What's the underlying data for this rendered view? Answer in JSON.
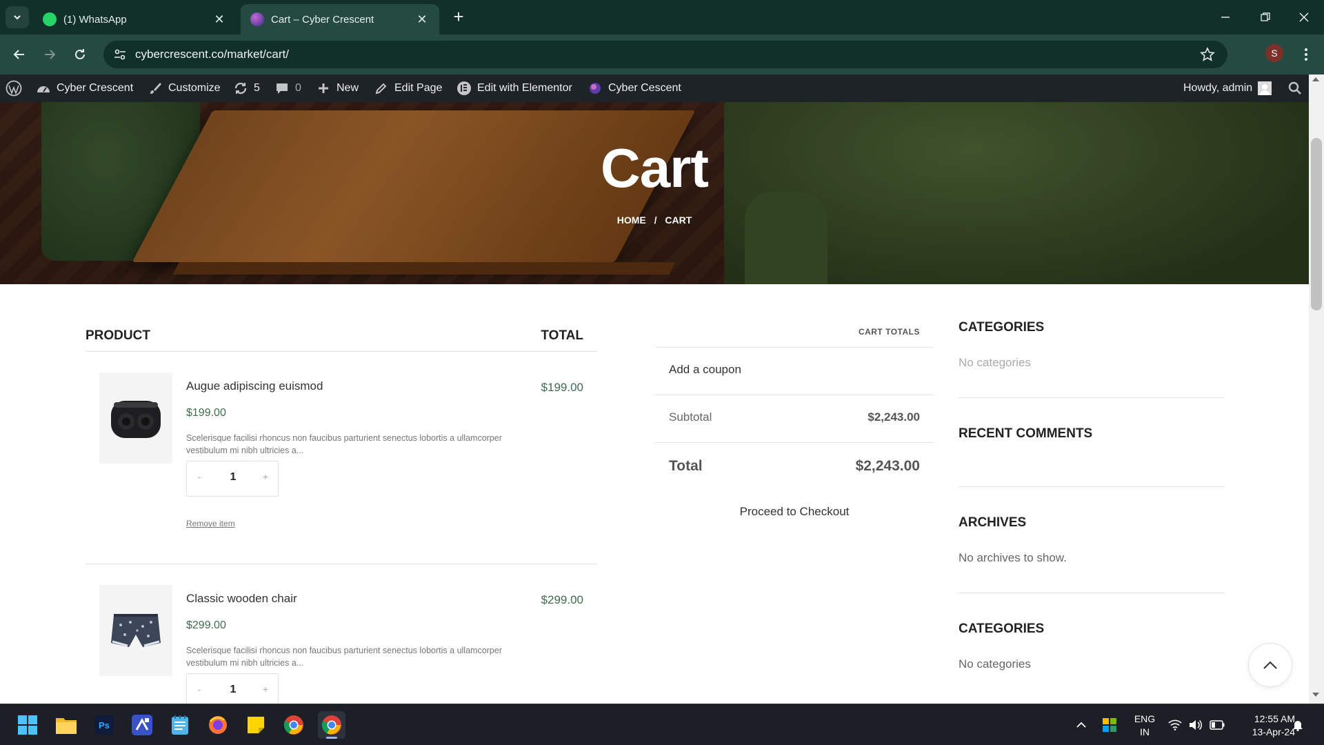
{
  "browser": {
    "tabs": [
      {
        "title": "(1) WhatsApp",
        "active": false
      },
      {
        "title": "Cart – Cyber Crescent",
        "active": true
      }
    ],
    "url": "cybercrescent.co/market/cart/",
    "profile_initial": "S"
  },
  "adminbar": {
    "site_name": "Cyber Crescent",
    "customize": "Customize",
    "updates_count": "5",
    "comments_count": "0",
    "new": "New",
    "edit_page": "Edit Page",
    "edit_elementor": "Edit with Elementor",
    "site_link": "Cyber Cescent",
    "howdy": "Howdy, admin"
  },
  "hero": {
    "title": "Cart",
    "breadcrumb": {
      "home": "HOME",
      "separator": "/",
      "current": "CART"
    }
  },
  "cart": {
    "col_product": "PRODUCT",
    "col_total": "TOTAL",
    "items": [
      {
        "name": "Augue adipiscing euismod",
        "price": "$199.00",
        "description": "Scelerisque facilisi rhoncus non faucibus parturient senectus lobortis a ullamcorper vestibulum mi nibh ultricies a...",
        "qty_minus": "-",
        "quantity": "1",
        "qty_plus": "+",
        "remove": "Remove item",
        "total": "$199.00"
      },
      {
        "name": "Classic wooden chair",
        "price": "$299.00",
        "description": "Scelerisque facilisi rhoncus non faucibus parturient senectus lobortis a ullamcorper vestibulum mi nibh ultricies a...",
        "qty_minus": "-",
        "quantity": "1",
        "qty_plus": "+",
        "total": "$299.00"
      }
    ]
  },
  "totals": {
    "caption": "CART TOTALS",
    "coupon": "Add a coupon",
    "subtotal_label": "Subtotal",
    "subtotal_value": "$2,243.00",
    "total_label": "Total",
    "total_value": "$2,243.00",
    "checkout": "Proceed to Checkout"
  },
  "sidebar": {
    "widgets": [
      {
        "title": "CATEGORIES",
        "text": "No categories"
      },
      {
        "title": "RECENT COMMENTS",
        "text": ""
      },
      {
        "title": "ARCHIVES",
        "text": "No archives to show."
      },
      {
        "title": "CATEGORIES",
        "text": "No categories"
      }
    ]
  },
  "taskbar": {
    "apps": [
      "start-icon",
      "file-explorer-icon",
      "photoshop-icon",
      "app-icon",
      "notepad-icon",
      "firefox-icon",
      "sticky-notes-icon",
      "chrome-icon",
      "chrome-icon"
    ],
    "lang_line1": "ENG",
    "lang_line2": "IN",
    "time": "12:55 AM",
    "date": "13-Apr-24"
  },
  "colors": {
    "tab_strip": "#12302a",
    "toolbar": "#244a42",
    "adminbar": "#1d2327",
    "price_green": "#3f6b4e"
  }
}
